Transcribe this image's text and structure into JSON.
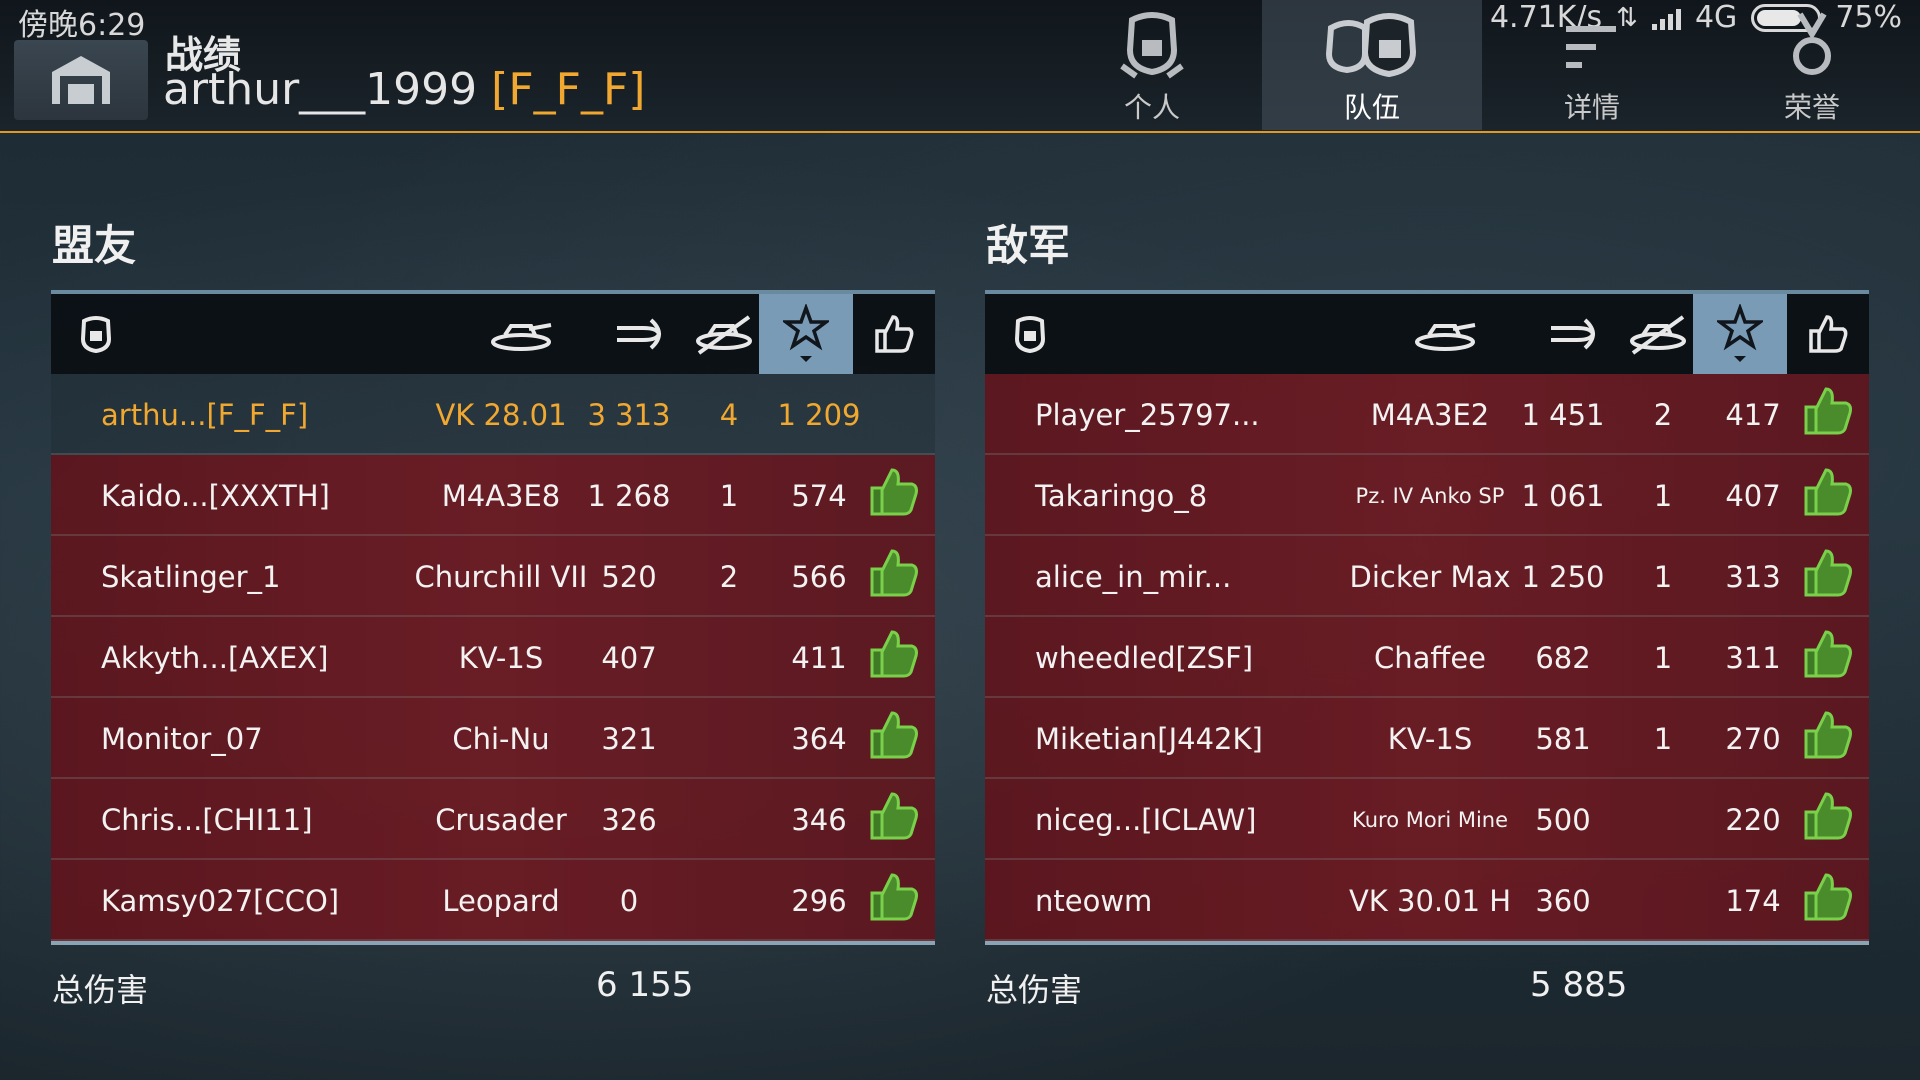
{
  "status": {
    "time": "傍晚6:29",
    "net_speed": "4.71K/s",
    "network": "4G",
    "battery": "75%",
    "battery_level": 0.75
  },
  "header": {
    "title": "战绩",
    "player_name": "arthur___1999",
    "player_clan": "[F_F_F]"
  },
  "tabs": [
    {
      "label": "个人",
      "icon": "single-helmet-icon",
      "active": false
    },
    {
      "label": "队伍",
      "icon": "team-helmets-icon",
      "active": true
    },
    {
      "label": "详情",
      "icon": "details-lines-icon",
      "active": false
    },
    {
      "label": "荣誉",
      "icon": "medal-icon",
      "active": false
    }
  ],
  "allies": {
    "title": "盟友",
    "total_label": "总伤害",
    "total_damage": "6 155",
    "rows": [
      {
        "name": "arthu...[F_F_F]",
        "tank": "VK 28.01",
        "damage": "3 313",
        "kills": "4",
        "xp": "1 209",
        "liked": false,
        "self": true
      },
      {
        "name": "Kaido...[XXXTH]",
        "tank": "M4A3E8",
        "damage": "1 268",
        "kills": "1",
        "xp": "574",
        "liked": true,
        "self": false
      },
      {
        "name": "Skatlinger_1",
        "tank": "Churchill VII",
        "damage": "520",
        "kills": "2",
        "xp": "566",
        "liked": true,
        "self": false
      },
      {
        "name": "Akkyth...[AXEX]",
        "tank": "KV-1S",
        "damage": "407",
        "kills": "",
        "xp": "411",
        "liked": true,
        "self": false
      },
      {
        "name": "Monitor_07",
        "tank": "Chi-Nu",
        "damage": "321",
        "kills": "",
        "xp": "364",
        "liked": true,
        "self": false
      },
      {
        "name": "Chris...[CHI11]",
        "tank": "Crusader",
        "damage": "326",
        "kills": "",
        "xp": "346",
        "liked": true,
        "self": false
      },
      {
        "name": "Kamsy027[CCO]",
        "tank": "Leopard",
        "damage": "0",
        "kills": "",
        "xp": "296",
        "liked": true,
        "self": false
      }
    ]
  },
  "enemies": {
    "title": "敌军",
    "total_label": "总伤害",
    "total_damage": "5 885",
    "rows": [
      {
        "name": "Player_25797...",
        "tank": "M4A3E2",
        "damage": "1 451",
        "kills": "2",
        "xp": "417",
        "liked": true,
        "small": false
      },
      {
        "name": "Takaringo_8",
        "tank": "Pz. IV Anko SP",
        "damage": "1 061",
        "kills": "1",
        "xp": "407",
        "liked": true,
        "small": true
      },
      {
        "name": "alice_in_mir...",
        "tank": "Dicker Max",
        "damage": "1 250",
        "kills": "1",
        "xp": "313",
        "liked": true,
        "small": false
      },
      {
        "name": "wheedled[ZSF]",
        "tank": "Chaffee",
        "damage": "682",
        "kills": "1",
        "xp": "311",
        "liked": true,
        "small": false
      },
      {
        "name": "Miketian[J442K]",
        "tank": "KV-1S",
        "damage": "581",
        "kills": "1",
        "xp": "270",
        "liked": true,
        "small": false
      },
      {
        "name": "niceg...[ICLAW]",
        "tank": "Kuro Mori Mine",
        "damage": "500",
        "kills": "",
        "xp": "220",
        "liked": true,
        "small": true
      },
      {
        "name": "nteowm",
        "tank": "VK 30.01 H",
        "damage": "360",
        "kills": "",
        "xp": "174",
        "liked": true,
        "small": false
      }
    ]
  },
  "columns": [
    {
      "icon": "player-helmet-icon"
    },
    {
      "icon": "tank-icon"
    },
    {
      "icon": "damage-shell-icon"
    },
    {
      "icon": "destroyed-tank-icon"
    },
    {
      "icon": "star-icon",
      "sorted": true
    },
    {
      "icon": "thumbs-up-icon"
    }
  ],
  "colors": {
    "accent": "#e09a24",
    "clan": "#f0a830",
    "row_red": "#6e1a22",
    "sorted_column": "#7a9bb6",
    "like_green": "#7ad04a"
  }
}
